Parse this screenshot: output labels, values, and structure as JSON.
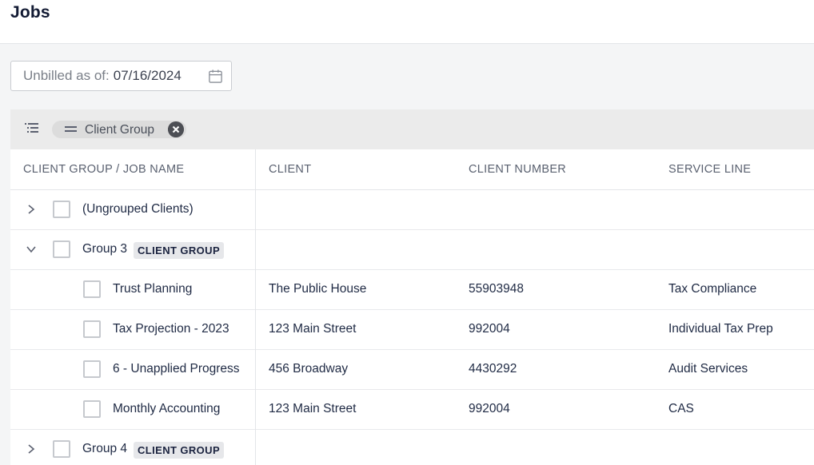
{
  "header": {
    "title": "Jobs"
  },
  "filter": {
    "label": "Unbilled as of:",
    "date": "07/16/2024",
    "icon": "calendar-icon"
  },
  "grouping": {
    "chip_label": "Client Group",
    "icon": "group-rows-icon"
  },
  "columns": [
    "CLIENT GROUP / JOB NAME",
    "CLIENT",
    "CLIENT NUMBER",
    "SERVICE LINE"
  ],
  "groups": [
    {
      "name": "(Ungrouped Clients)",
      "tag": "",
      "expanded": false
    },
    {
      "name": "Group 3",
      "tag": "CLIENT GROUP",
      "expanded": true
    },
    {
      "name": "Group 4",
      "tag": "CLIENT GROUP",
      "expanded": false
    }
  ],
  "jobs": [
    {
      "job": "Trust Planning",
      "client": "The Public House",
      "number": "55903948",
      "service": "Tax Compliance"
    },
    {
      "job": "Tax Projection - 2023",
      "client": "123 Main Street",
      "number": "992004",
      "service": "Individual Tax Prep"
    },
    {
      "job": "6 - Unapplied Progress",
      "client": "456 Broadway",
      "number": "4430292",
      "service": "Audit Services"
    },
    {
      "job": "Monthly Accounting",
      "client": "123 Main Street",
      "number": "992004",
      "service": "CAS"
    }
  ],
  "colors": {
    "text": "#1f2a44",
    "header_bg": "#ebebeb",
    "tag_bg": "#e6e7ea"
  }
}
